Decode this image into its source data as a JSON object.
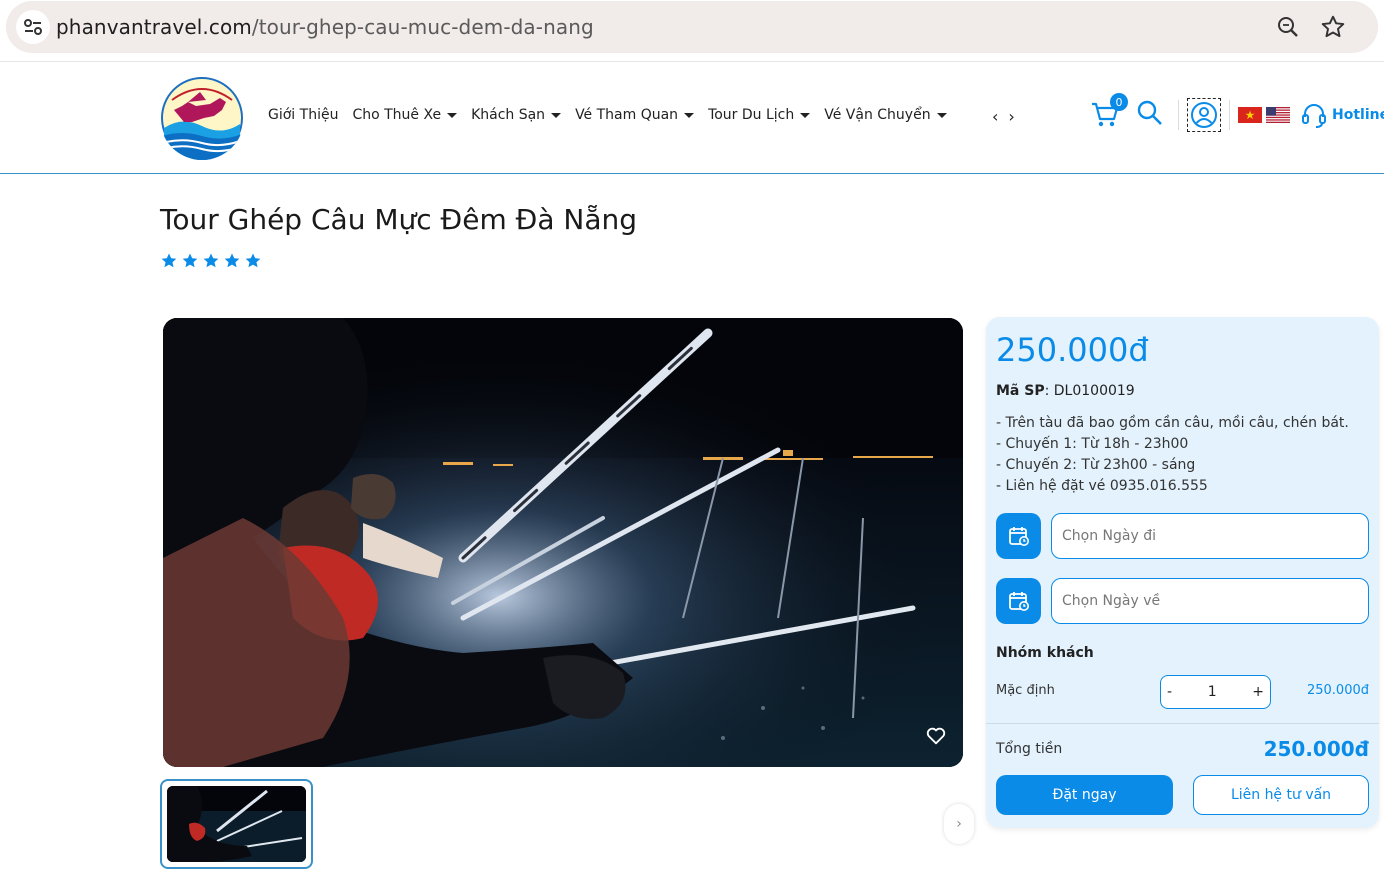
{
  "browser": {
    "url_host": "phanvantravel.com",
    "url_path": "/tour-ghep-cau-muc-dem-da-nang"
  },
  "header": {
    "logo_alt": "CÔNG TY TNHH PHAN VÂN",
    "nav": [
      {
        "label": "Giới Thiệu",
        "has_caret": false
      },
      {
        "label": "Cho Thuê Xe",
        "has_caret": true
      },
      {
        "label": "Khách Sạn",
        "has_caret": true
      },
      {
        "label": "Vé Tham Quan",
        "has_caret": true
      },
      {
        "label": "Tour Du Lịch",
        "has_caret": true
      },
      {
        "label": "Vé Vận Chuyển",
        "has_caret": true
      }
    ],
    "cart_count": "0",
    "hotline_label": "Hotline"
  },
  "product": {
    "title": "Tour Ghép Câu Mực Đêm Đà Nẵng",
    "rating_stars": 5,
    "price": "250.000đ",
    "sku_label": "Mã SP",
    "sku_value": ": DL0100019",
    "description": [
      "- Trên tàu đã bao gồm cần câu, mồi câu, chén bát.",
      "- Chuyến 1: Từ 18h - 23h00",
      "- Chuyến 2: Từ  23h00 - sáng",
      "- Liên hệ đặt vé 0935.016.555"
    ]
  },
  "booking": {
    "depart_placeholder": "Chọn Ngày đi",
    "return_placeholder": "Chọn Ngày về",
    "group_title": "Nhóm khách",
    "default_label": "Mặc định",
    "minus": "-",
    "quantity": "1",
    "plus": "+",
    "unit_price": "250.000đ",
    "total_label": "Tổng tiền",
    "total_value": "250.000đ",
    "book_button": "Đặt ngay",
    "contact_button": "Liên hệ tư vấn"
  },
  "colors": {
    "accent": "#0a8be8",
    "card_bg": "#e3f2fc",
    "star": "#0a8be8"
  }
}
